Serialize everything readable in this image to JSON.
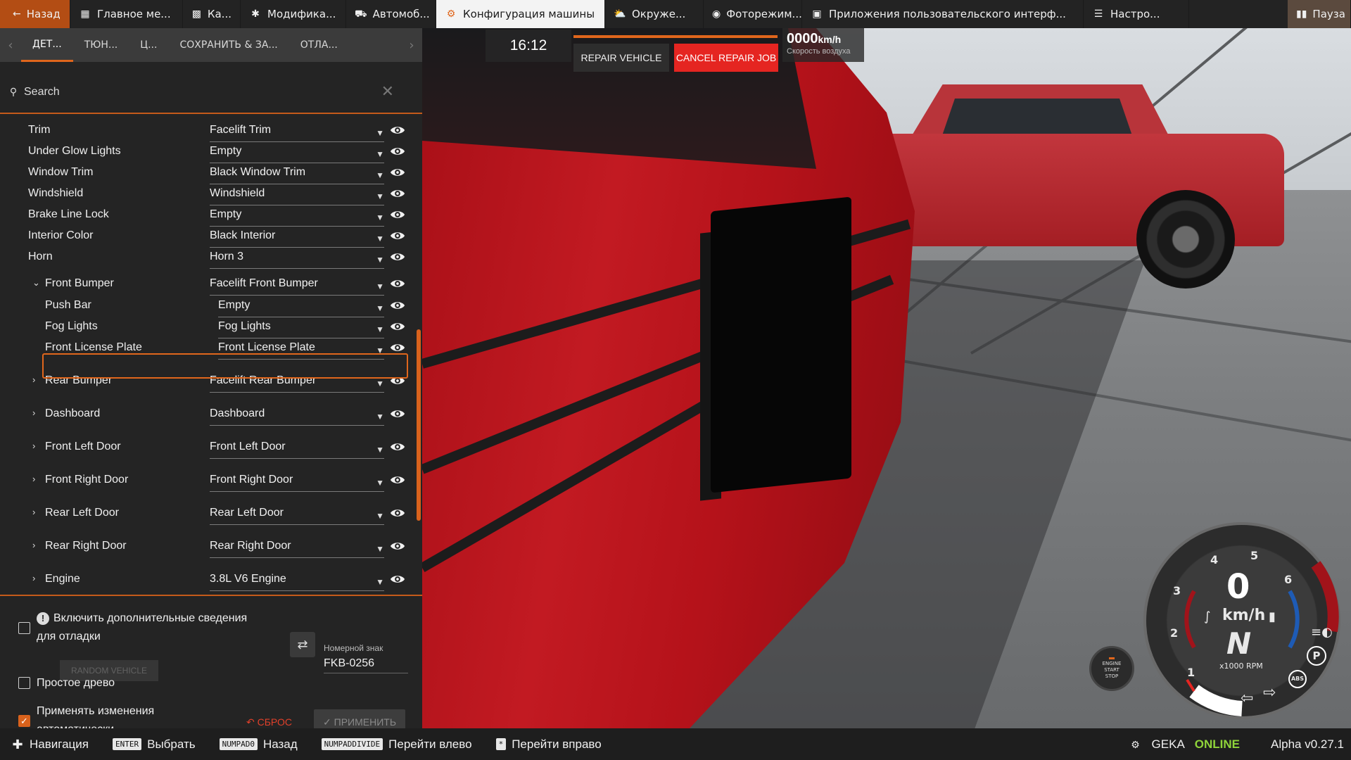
{
  "topbar": {
    "back": "Назад",
    "tabs": [
      "Главное ме...",
      "Ка...",
      "Модифика...",
      "Автомоб...",
      "Конфигурация машины",
      "Окруже...",
      "Фоторежим...",
      "Приложения пользовательского интерф...",
      "Настро..."
    ],
    "pause": "Пауза"
  },
  "subtabs": [
    "ДЕТ...",
    "ТЮН...",
    "Ц...",
    "СОХРАНИТЬ & ЗА...",
    "ОТЛА..."
  ],
  "search": {
    "placeholder": "Search"
  },
  "parts": [
    {
      "label": "Trim",
      "value": "Facelift Trim"
    },
    {
      "label": "Under Glow Lights",
      "value": "Empty"
    },
    {
      "label": "Window Trim",
      "value": "Black Window Trim"
    },
    {
      "label": "Windshield",
      "value": "Windshield"
    },
    {
      "label": "Brake Line Lock",
      "value": "Empty"
    },
    {
      "label": "Interior Color",
      "value": "Black Interior"
    },
    {
      "label": "Horn",
      "value": "Horn 3"
    },
    {
      "label": "Front Bumper",
      "value": "Facelift Front Bumper"
    },
    {
      "label": "Push Bar",
      "value": "Empty"
    },
    {
      "label": "Fog Lights",
      "value": "Fog Lights"
    },
    {
      "label": "Front License Plate",
      "value": "Front License Plate"
    },
    {
      "label": "Rear Bumper",
      "value": "Facelift Rear Bumper"
    },
    {
      "label": "Dashboard",
      "value": "Dashboard"
    },
    {
      "label": "Front Left Door",
      "value": "Front Left Door"
    },
    {
      "label": "Front Right Door",
      "value": "Front Right Door"
    },
    {
      "label": "Rear Left Door",
      "value": "Rear Left Door"
    },
    {
      "label": "Rear Right Door",
      "value": "Rear Right Door"
    },
    {
      "label": "Engine",
      "value": "3.8L V6 Engine"
    }
  ],
  "options": {
    "debug_1": "Включить дополнительные сведения",
    "debug_2": "для отладки",
    "simple_tree": "Простое древо",
    "auto_apply_1": "Применять изменения",
    "auto_apply_2": "автоматически",
    "random_vehicle": "RANDOM VEHICLE",
    "plate_label": "Номерной знак",
    "plate_value": "FKB-0256",
    "reset": "СБРОС",
    "apply": "ПРИМЕНИТЬ"
  },
  "hud": {
    "time": "16:12",
    "repair": "REPAIR VEHICLE",
    "cancel": "CANCEL REPAIR JOB",
    "airspeed_value": "0000",
    "airspeed_unit": "km/h",
    "airspeed_label": "Скорость воздуха"
  },
  "gauge": {
    "speed": "0",
    "unit": "km/h",
    "gear": "N",
    "rpm_label": "x1000 RPM",
    "ticks": [
      "1",
      "2",
      "3",
      "4",
      "5",
      "6"
    ],
    "engine_btn": [
      "ENGINE",
      "START",
      "STOP"
    ],
    "rpm": 0,
    "park_brake": "P",
    "abs": "ABS"
  },
  "bottombar": {
    "items": [
      {
        "key": "",
        "label": "Навигация"
      },
      {
        "key": "ENTER",
        "label": "Выбрать"
      },
      {
        "key": "NUMPAD0",
        "label": "Назад"
      },
      {
        "key": "NUMPADDIVIDE",
        "label": "Перейти влево"
      },
      {
        "key": "*",
        "label": "Перейти вправо"
      }
    ],
    "user": "GEKA",
    "status": "ONLINE",
    "version": "Alpha v0.27.1"
  },
  "colors": {
    "accent": "#e0661c",
    "cancel": "#e52521",
    "online": "#8fd43a"
  }
}
